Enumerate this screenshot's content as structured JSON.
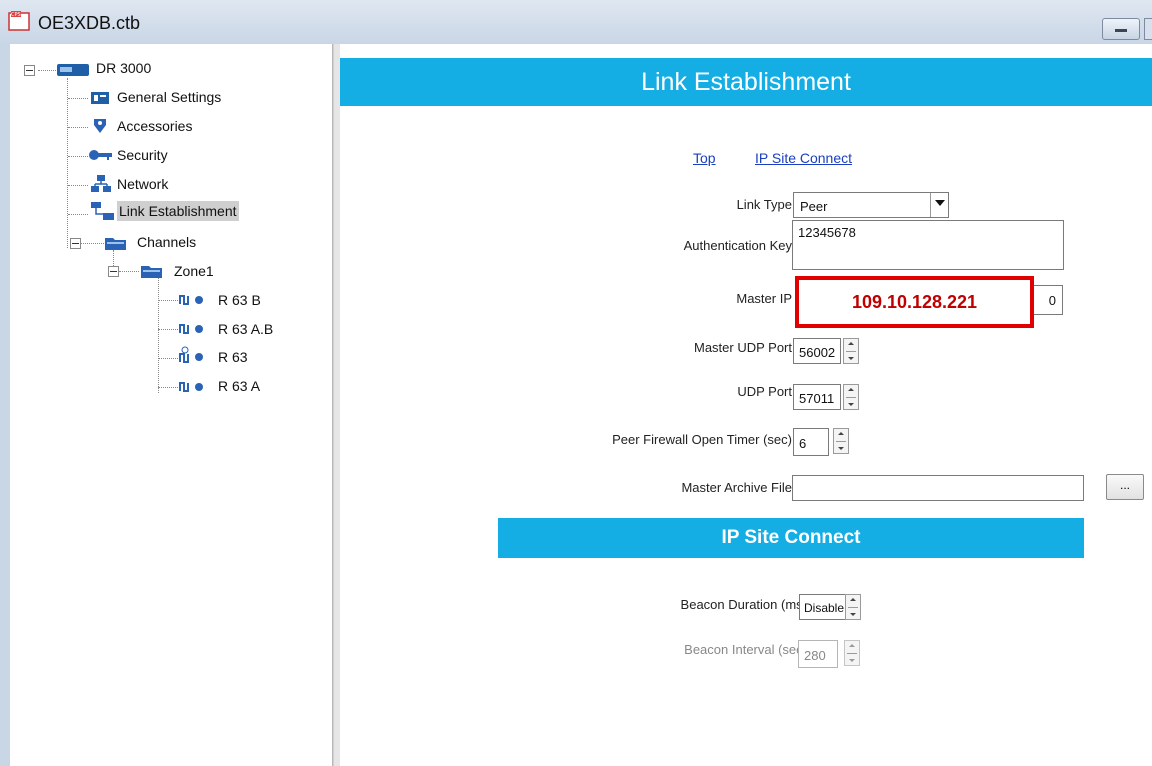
{
  "window": {
    "title": "OE3XDB.ctb"
  },
  "tree": {
    "root": "DR 3000",
    "items": [
      {
        "label": "General Settings",
        "icon": "general-settings-icon"
      },
      {
        "label": "Accessories",
        "icon": "accessories-icon"
      },
      {
        "label": "Security",
        "icon": "key-icon"
      },
      {
        "label": "Network",
        "icon": "network-icon"
      },
      {
        "label": "Link Establishment",
        "icon": "link-icon",
        "selected": true
      },
      {
        "label": "Channels",
        "icon": "folder-icon"
      }
    ],
    "zone": "Zone1",
    "channels": [
      "R 63 B",
      "R 63 A.B",
      "R 63",
      "R 63 A"
    ]
  },
  "main": {
    "header": "Link Establishment",
    "links": {
      "top": "Top",
      "ip_site_connect": "IP Site Connect"
    },
    "fields": {
      "link_type": {
        "label": "Link Type",
        "value": "Peer"
      },
      "auth_key": {
        "label": "Authentication Key",
        "value": "12345678"
      },
      "master_ip": {
        "label": "Master IP",
        "value_tail": "0"
      },
      "master_udp_port": {
        "label": "Master UDP Port",
        "value": "56002"
      },
      "udp_port": {
        "label": "UDP Port",
        "value": "57011"
      },
      "peer_firewall": {
        "label": "Peer Firewall Open Timer (sec)",
        "value": "6"
      },
      "master_archive": {
        "label": "Master Archive File",
        "value": "",
        "browse": "..."
      }
    },
    "ip_site_connect": {
      "header": "IP Site Connect",
      "beacon_duration": {
        "label": "Beacon Duration (ms)",
        "value": "Disable"
      },
      "beacon_interval": {
        "label": "Beacon Interval (sec)",
        "value": "280"
      }
    },
    "annotation": {
      "text": "109.10.128.221",
      "color": "#e00000"
    }
  },
  "colors": {
    "accent": "#14aee4",
    "highlight": "#e00000"
  }
}
